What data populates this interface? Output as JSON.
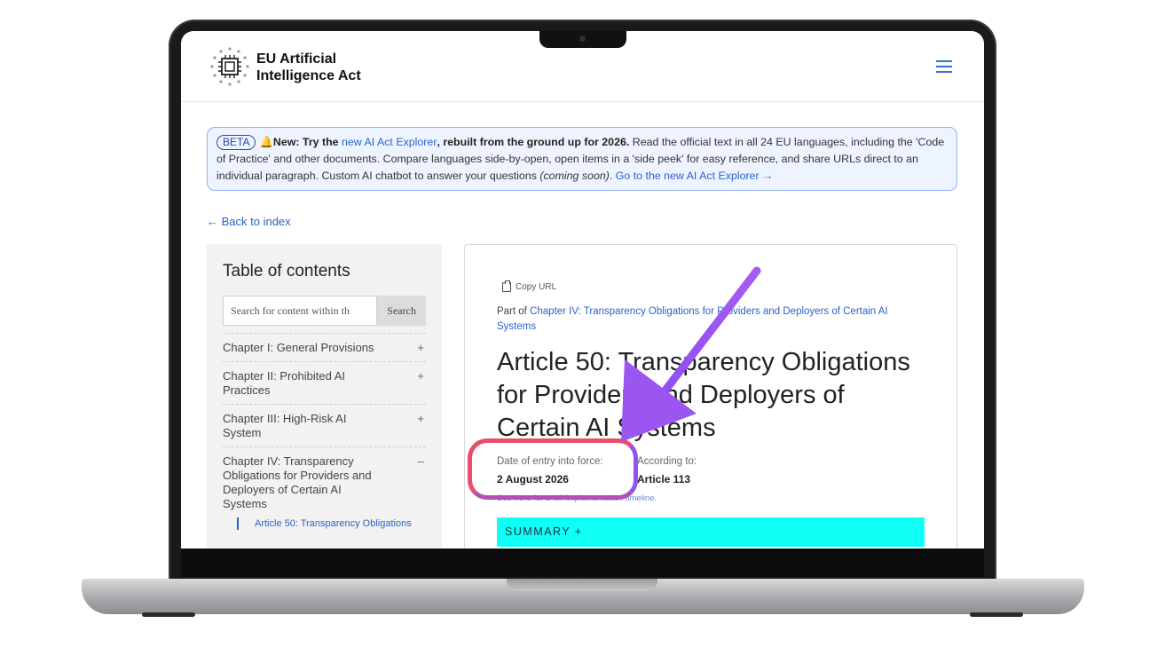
{
  "site": {
    "logo_line1": "EU Artificial",
    "logo_line2": "Intelligence Act"
  },
  "banner": {
    "badge": "BETA",
    "bell": "🔔",
    "new_label": "New: Try the ",
    "explorer_link": "new AI Act Explorer",
    "rebuilt": ", rebuilt from the ground up for 2026.",
    "body": " Read the official text in all 24 EU languages, including the 'Code of Practice' and other documents. Compare languages side-by-open, open items in a 'side peek' for easy reference, and share URLs direct to an individual paragraph. Custom AI chatbot to answer your questions ",
    "coming_soon": "(coming soon)",
    "period": ". ",
    "cta": "Go to the new AI Act Explorer →"
  },
  "back_link": "← Back to index",
  "toc": {
    "title": "Table of contents",
    "search_placeholder": "Search for content within th",
    "search_button": "Search",
    "items": [
      {
        "label": "Chapter I: General Provisions",
        "toggle": "+"
      },
      {
        "label": "Chapter II: Prohibited AI Practices",
        "toggle": "+"
      },
      {
        "label": "Chapter III: High-Risk AI System",
        "toggle": "+"
      },
      {
        "label": "Chapter IV: Transparency Obligations for Providers and Deployers of Certain AI Systems",
        "toggle": "–"
      }
    ],
    "sub_item": "Article 50: Transparency Obligations"
  },
  "article": {
    "copy_url": "Copy URL",
    "part_of_prefix": "Part of ",
    "part_of_link": "Chapter IV: Transparency Obligations for Providers and Deployers of Certain AI Systems",
    "title": "Article 50: Transparency Obligations for Providers and Deployers of Certain AI Systems",
    "entry_label": "Date of entry into force:",
    "entry_value": "2 August 2026",
    "according_label": "According to:",
    "according_value": "Article 113",
    "timeline_link": "See here for a full implementation timeline.",
    "summary": "SUMMARY +"
  },
  "colors": {
    "accent_blue": "#2b62c9",
    "summary_bg": "#0ffff6",
    "ring_red": "#e94d6a",
    "arrow_purple": "#9b55f0"
  }
}
